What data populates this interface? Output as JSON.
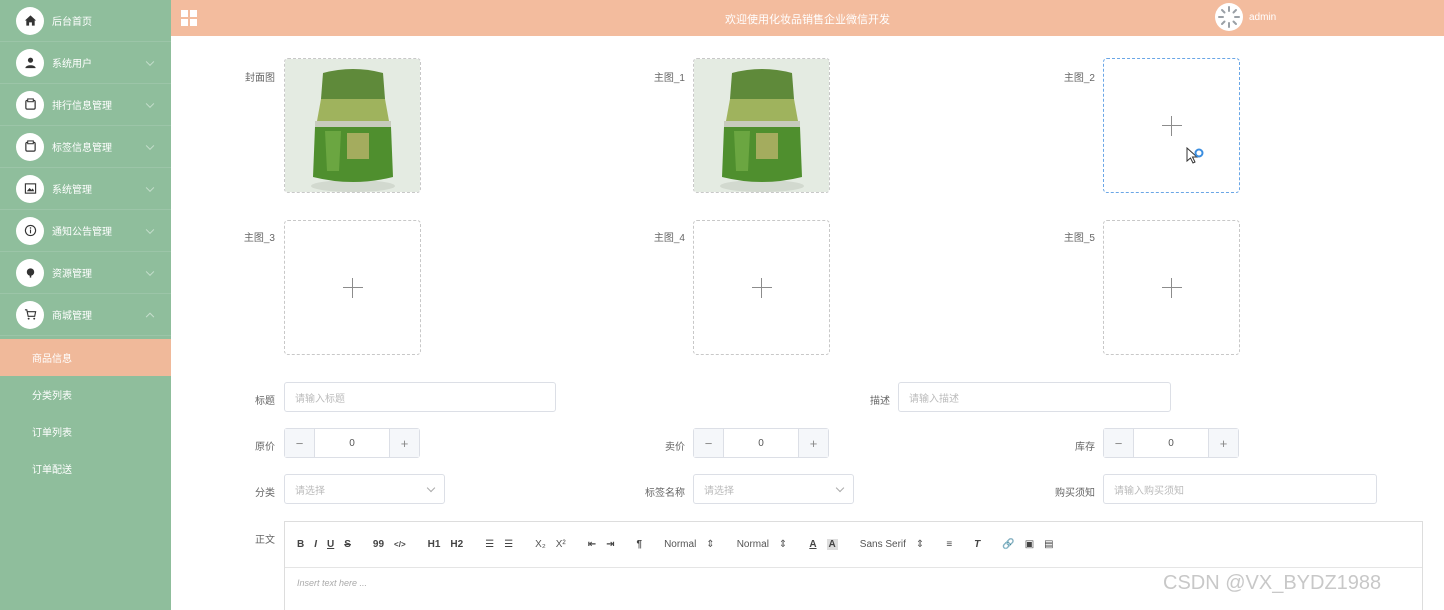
{
  "sidebar": {
    "items": [
      {
        "label": "后台首页",
        "icon": "home-icon"
      },
      {
        "label": "系统用户",
        "icon": "user-icon"
      },
      {
        "label": "排行信息管理",
        "icon": "panel-icon"
      },
      {
        "label": "标签信息管理",
        "icon": "panel-icon"
      },
      {
        "label": "系统管理",
        "icon": "image-icon"
      },
      {
        "label": "通知公告管理",
        "icon": "info-icon"
      },
      {
        "label": "资源管理",
        "icon": "dot-icon"
      },
      {
        "label": "商城管理",
        "icon": "cart-icon"
      }
    ],
    "sub_items": [
      "商品信息",
      "分类列表",
      "订单列表",
      "订单配送"
    ],
    "colors": {
      "background": "#8fbe9c",
      "active": "#f0b99a"
    }
  },
  "header": {
    "title": "欢迎使用化妆品销售企业微信开发",
    "user": "admin",
    "color": "#f3bc9e"
  },
  "form": {
    "images": [
      {
        "label": "封面图",
        "has_image": true
      },
      {
        "label": "主图_1",
        "has_image": true
      },
      {
        "label": "主图_2",
        "has_image": false
      },
      {
        "label": "主图_3",
        "has_image": false
      },
      {
        "label": "主图_4",
        "has_image": false
      },
      {
        "label": "主图_5",
        "has_image": false
      }
    ],
    "title_label": "标题",
    "title_placeholder": "请输入标题",
    "desc_label": "描述",
    "desc_placeholder": "请输入描述",
    "original_price_label": "原价",
    "original_price": "0",
    "sale_price_label": "卖价",
    "sale_price": "0",
    "stock_label": "库存",
    "stock": "0",
    "category_label": "分类",
    "category_placeholder": "请选择",
    "tag_label": "标签名称",
    "tag_placeholder": "请选择",
    "notice_label": "购买须知",
    "notice_placeholder": "请输入购买须知",
    "body_label": "正文",
    "editor_placeholder": "Insert text here ...",
    "toolbar": {
      "bold": "B",
      "italic": "I",
      "underline": "U",
      "strike": "S",
      "quote": "99",
      "code": "</>",
      "h1": "H1",
      "h2": "H2",
      "sub": "X₂",
      "sup": "X²",
      "size": "Normal",
      "header": "Normal",
      "font": "Sans Serif"
    }
  },
  "watermark": "CSDN @VX_BYDZ1988"
}
